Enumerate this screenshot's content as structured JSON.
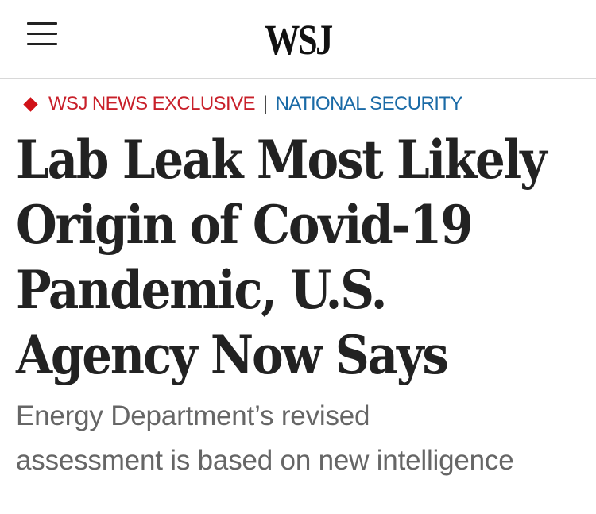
{
  "header": {
    "logo": "WSJ"
  },
  "kicker": {
    "label": "WSJ NEWS EXCLUSIVE",
    "separator": "|",
    "section": "NATIONAL SECURITY"
  },
  "article": {
    "headline_lines": [
      "Lab Leak Most Likely",
      "Origin of Covid-19",
      "Pandemic, U.S.",
      "Agency Now Says"
    ],
    "dek_lines": [
      "Energy Department’s revised",
      "assessment is based on new intelligence"
    ]
  },
  "icons": {
    "menu": "hamburger-menu-icon",
    "kicker_marker": "red-diamond-icon"
  },
  "colors": {
    "exclusive_red": "#c8202a",
    "section_blue": "#1a6aa6",
    "headline": "#222222",
    "dek": "#666666"
  }
}
